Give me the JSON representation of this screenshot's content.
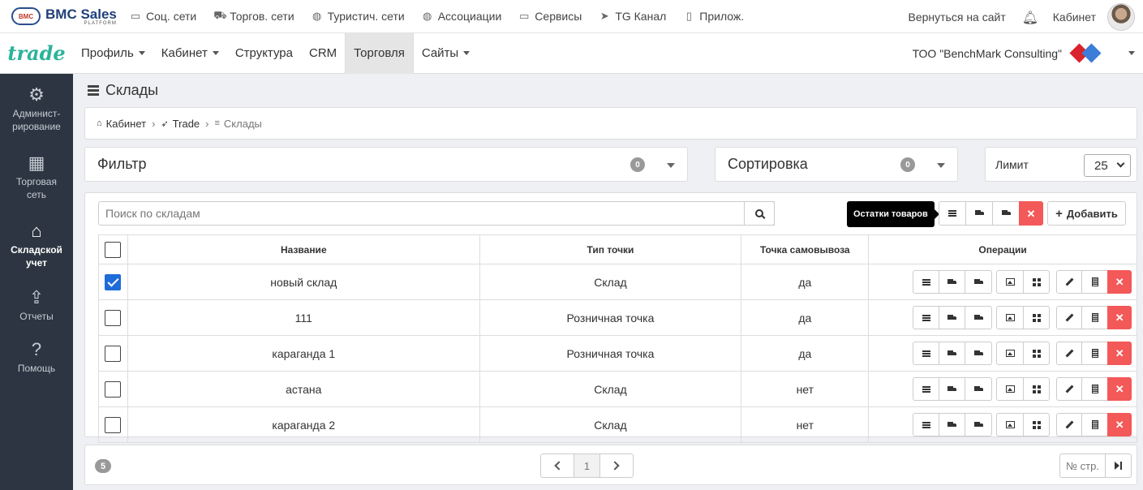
{
  "topbar": {
    "brand_name": "BMC Sales",
    "brand_sub": "PLATFORM",
    "brand_logo_text": "BMC",
    "nav": [
      {
        "label": "Соц. сети",
        "icon": "chat-icon"
      },
      {
        "label": "Торгов. сети",
        "icon": "cart-icon"
      },
      {
        "label": "Туристич. сети",
        "icon": "globe-icon"
      },
      {
        "label": "Ассоциации",
        "icon": "network-icon"
      },
      {
        "label": "Сервисы",
        "icon": "briefcase-icon"
      },
      {
        "label": "TG Канал",
        "icon": "telegram-icon"
      },
      {
        "label": "Прилож.",
        "icon": "phone-icon"
      }
    ],
    "back_to_site": "Вернуться на сайт",
    "cabinet": "Кабинет"
  },
  "navbar": {
    "logo": "trade",
    "items": [
      {
        "label": "Профиль",
        "dropdown": true
      },
      {
        "label": "Кабинет",
        "dropdown": true
      },
      {
        "label": "Структура",
        "dropdown": false
      },
      {
        "label": "CRM",
        "dropdown": false
      },
      {
        "label": "Торговля",
        "dropdown": false,
        "active": true
      },
      {
        "label": "Сайты",
        "dropdown": true
      }
    ],
    "company": "ТОО \"BenchMark Consulting\""
  },
  "sidebar": {
    "items": [
      {
        "label": "Админист-рирование",
        "line1": "Админист-",
        "line2": "рирование",
        "icon": "gears-icon"
      },
      {
        "label": "Торговая сеть",
        "line1": "Торговая",
        "line2": "сеть",
        "icon": "store-icon"
      },
      {
        "label": "Складской учет",
        "line1": "Складской",
        "line2": "учет",
        "icon": "warehouse-icon",
        "active": true
      },
      {
        "label": "Отчеты",
        "line1": "Отчеты",
        "line2": "",
        "icon": "share-icon"
      },
      {
        "label": "Помощь",
        "line1": "Помощь",
        "line2": "",
        "icon": "help-icon"
      }
    ]
  },
  "page": {
    "title": "Склады",
    "breadcrumb": [
      "Кабинет",
      "Trade",
      "Склады"
    ]
  },
  "filter": {
    "title": "Фильтр",
    "count": "0"
  },
  "sort": {
    "title": "Сортировка",
    "count": "0"
  },
  "limit": {
    "label": "Лимит",
    "value": "25"
  },
  "search": {
    "placeholder": "Поиск по складам"
  },
  "toolbar": {
    "tooltip": "Остатки товаров",
    "add_label": "Добавить"
  },
  "table": {
    "columns": [
      "Название",
      "Тип точки",
      "Точка самовывоза",
      "Операции"
    ],
    "rows": [
      {
        "name": "новый склад",
        "type": "Склад",
        "pickup": "да",
        "checked": true
      },
      {
        "name": "111",
        "type": "Розничная точка",
        "pickup": "да",
        "checked": false
      },
      {
        "name": "караганда 1",
        "type": "Розничная точка",
        "pickup": "да",
        "checked": false
      },
      {
        "name": "астана",
        "type": "Склад",
        "pickup": "нет",
        "checked": false
      },
      {
        "name": "караганда 2",
        "type": "Склад",
        "pickup": "нет",
        "checked": false
      }
    ]
  },
  "pagination": {
    "total": "5",
    "current_page": "1",
    "goto_label": "№ стр."
  },
  "colors": {
    "accent_red": "#f35958",
    "checkbox_blue": "#1e6cd8",
    "sidebar_bg": "#2c3541",
    "logo_green": "#2bb39a"
  }
}
